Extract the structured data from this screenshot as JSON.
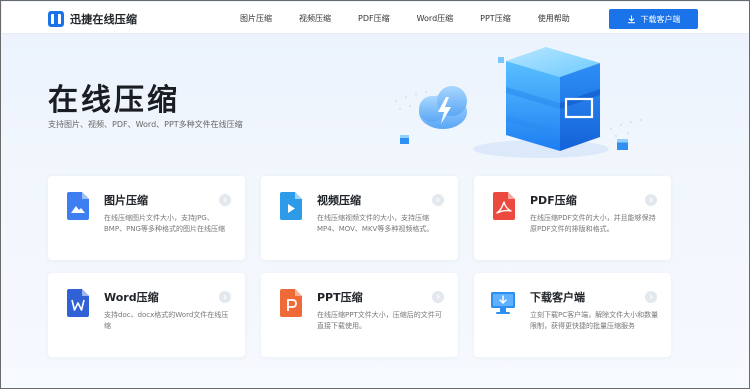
{
  "brand": {
    "name": "迅捷在线压缩"
  },
  "nav": {
    "links": [
      "图片压缩",
      "视频压缩",
      "PDF压缩",
      "Word压缩",
      "PPT压缩",
      "使用帮助"
    ],
    "download_label": "下载客户端"
  },
  "hero": {
    "title": "在线压缩",
    "subtitle": "支持图片、视频、PDF、Word、PPT多种文件在线压缩"
  },
  "cards": [
    {
      "title": "图片压缩",
      "desc": "在线压缩图片文件大小，支持JPG、BMP、PNG等多种格式的图片在线压缩",
      "icon": "image-file-icon",
      "color": "#3d7ff0"
    },
    {
      "title": "视频压缩",
      "desc": "在线压缩视频文件的大小，支持压缩MP4、MOV、MKV等多种视频格式。",
      "icon": "video-file-icon",
      "color": "#2d9be8"
    },
    {
      "title": "PDF压缩",
      "desc": "在线压缩PDF文件的大小，并且能够保持原PDF文件的排版和格式。",
      "icon": "pdf-file-icon",
      "color": "#ec4a3f"
    },
    {
      "title": "Word压缩",
      "desc": "支持doc、docx格式的Word文件在线压缩",
      "icon": "word-file-icon",
      "color": "#3062d6"
    },
    {
      "title": "PPT压缩",
      "desc": "在线压缩PPT文件大小，压缩后的文件可直接下载使用。",
      "icon": "ppt-file-icon",
      "color": "#f06a37"
    },
    {
      "title": "下载客户端",
      "desc": "立刻下载PC客户端，解除文件大小和数量限制，获得更快捷的批量压缩服务",
      "icon": "desktop-download-icon",
      "color": "#2d8ff0"
    }
  ]
}
